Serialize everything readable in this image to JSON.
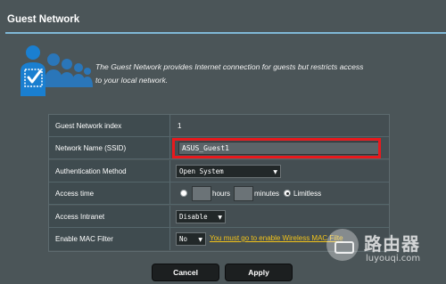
{
  "page": {
    "title": "Guest Network",
    "description_line1": "The Guest Network provides Internet connection for guests but restricts access",
    "description_line2": "to your local network."
  },
  "settings": {
    "index_label": "Guest Network index",
    "index_value": "1",
    "ssid_label": "Network Name (SSID)",
    "ssid_value": "ASUS_Guest1",
    "auth_label": "Authentication Method",
    "auth_value": "Open System",
    "access_time_label": "Access time",
    "hours_label": "hours",
    "minutes_label": "minutes",
    "limitless_label": "Limitless",
    "access_time_selected": "Limitless",
    "intranet_label": "Access Intranet",
    "intranet_value": "Disable",
    "mac_filter_label": "Enable MAC Filter",
    "mac_filter_value": "No",
    "mac_filter_link": "You must go to enable Wireless MAC Filte"
  },
  "buttons": {
    "cancel": "Cancel",
    "apply": "Apply"
  },
  "watermark": {
    "name": "路由器",
    "url": "luyouqi.com"
  },
  "colors": {
    "background": "#4b5558",
    "accent_rule": "#7fb8d6",
    "highlight": "#e8191d",
    "link": "#f2c31a",
    "icon_blue": "#1a7fd0"
  },
  "icons": {
    "guest_users": "guest-users-check-icon"
  }
}
